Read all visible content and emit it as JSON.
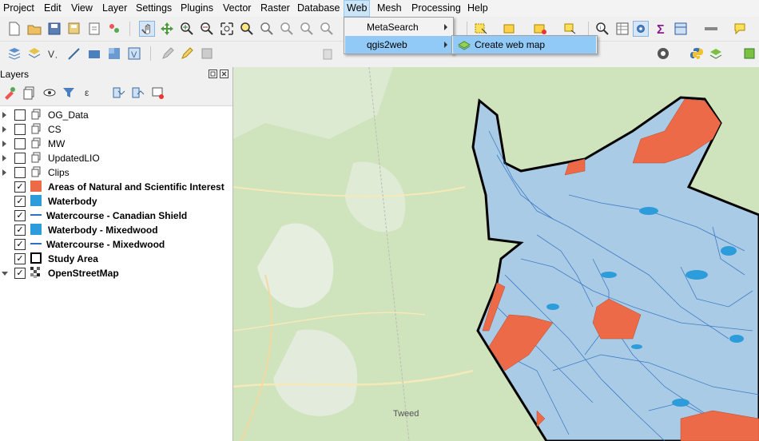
{
  "menubar": {
    "items": [
      "Project",
      "Edit",
      "View",
      "Layer",
      "Settings",
      "Plugins",
      "Vector",
      "Raster",
      "Database",
      "Web",
      "Mesh",
      "Processing",
      "Help"
    ],
    "active": "Web"
  },
  "web_menu": {
    "items": [
      {
        "label": "MetaSearch",
        "has_submenu": true
      },
      {
        "label": "qgis2web",
        "has_submenu": true
      }
    ]
  },
  "qgis2web_submenu": {
    "items": [
      {
        "label": "Create web map"
      }
    ]
  },
  "layers_panel": {
    "title": "Layers",
    "layers": [
      {
        "name": "OG_Data",
        "checked": false,
        "symbol": "group-icon",
        "expanded": false,
        "bold": false
      },
      {
        "name": "CS",
        "checked": false,
        "symbol": "group-icon",
        "expanded": false,
        "bold": false
      },
      {
        "name": "MW",
        "checked": false,
        "symbol": "group-icon",
        "expanded": false,
        "bold": false
      },
      {
        "name": "UpdatedLIO",
        "checked": false,
        "symbol": "group-icon",
        "expanded": false,
        "bold": false
      },
      {
        "name": "Clips",
        "checked": false,
        "symbol": "group-icon",
        "expanded": false,
        "bold": false
      },
      {
        "name": "Areas of Natural and Scientific Interest",
        "checked": true,
        "symbol": "fill-orange",
        "bold": true
      },
      {
        "name": "Waterbody",
        "checked": true,
        "symbol": "fill-blue",
        "bold": true
      },
      {
        "name": "Watercourse - Canadian Shield",
        "checked": true,
        "symbol": "line-blue",
        "bold": true
      },
      {
        "name": "Waterbody - Mixedwood",
        "checked": true,
        "symbol": "fill-blue",
        "bold": true
      },
      {
        "name": "Watercourse - Mixedwood",
        "checked": true,
        "symbol": "line-blue",
        "bold": true
      },
      {
        "name": "Study Area",
        "checked": true,
        "symbol": "outline-black",
        "bold": true
      },
      {
        "name": "OpenStreetMap",
        "checked": true,
        "symbol": "raster-icon",
        "expanded": true,
        "bold": true
      }
    ]
  },
  "map": {
    "place_label": "Tweed"
  },
  "colors": {
    "asni_orange": "#ec6a47",
    "water_blue": "#2d9cdb",
    "menu_highlight": "#91c9f7",
    "map_green": "#cfe3bc"
  }
}
